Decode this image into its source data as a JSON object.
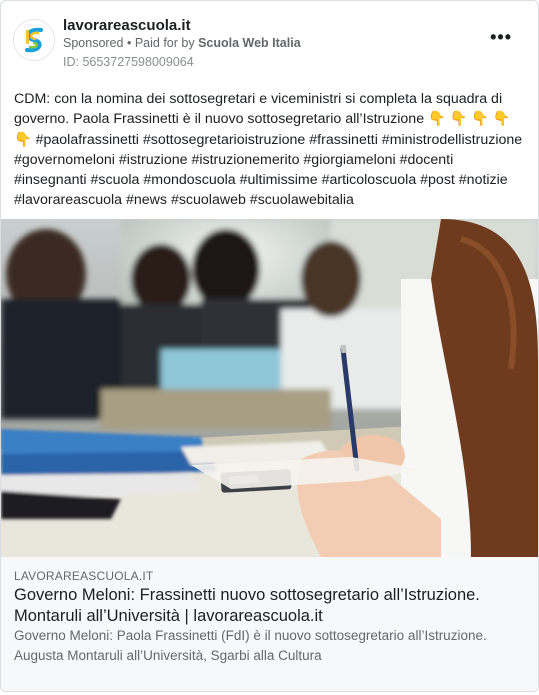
{
  "header": {
    "page_name": "lavorareascuola.it",
    "sponsored": "Sponsored",
    "separator": "•",
    "paid_for_prefix": "Paid for by",
    "payer": "Scuola Web Italia",
    "ad_id": "ID: 5653727598009064",
    "more_label": "•••"
  },
  "post": {
    "text": "CDM: con la nomina dei sottosegretari e viceministri si completa la squadra di governo. Paola Frassinetti è il nuovo sottosegretario all’Istruzione 👇 👇 👇 👇 👇 #paolafrassinetti #sottosegretarioistruzione #frassinetti #ministrodellistruzione #governomeloni #istruzione #istruzionemerito #giorgiameloni #docenti #insegnanti #scuola #mondoscuola #ultimissime #articoloscuola #post #notizie #lavorareascuola #news #scuolaweb #scuolawebitalia"
  },
  "link": {
    "domain": "LAVORAREASCUOLA.IT",
    "title": "Governo Meloni: Frassinetti nuovo sottosegretario all’Istruzione. Montaruli all’Università | lavorareascuola.it",
    "description": "Governo Meloni: Paola Frassinetti (FdI) è il nuovo sottosegretario all’Istruzione. Augusta Montaruli all’Università, Sgarbi alla Cultura"
  },
  "icons": {
    "logo": "lavorareascuola-logo-icon",
    "more": "more-options-icon"
  }
}
